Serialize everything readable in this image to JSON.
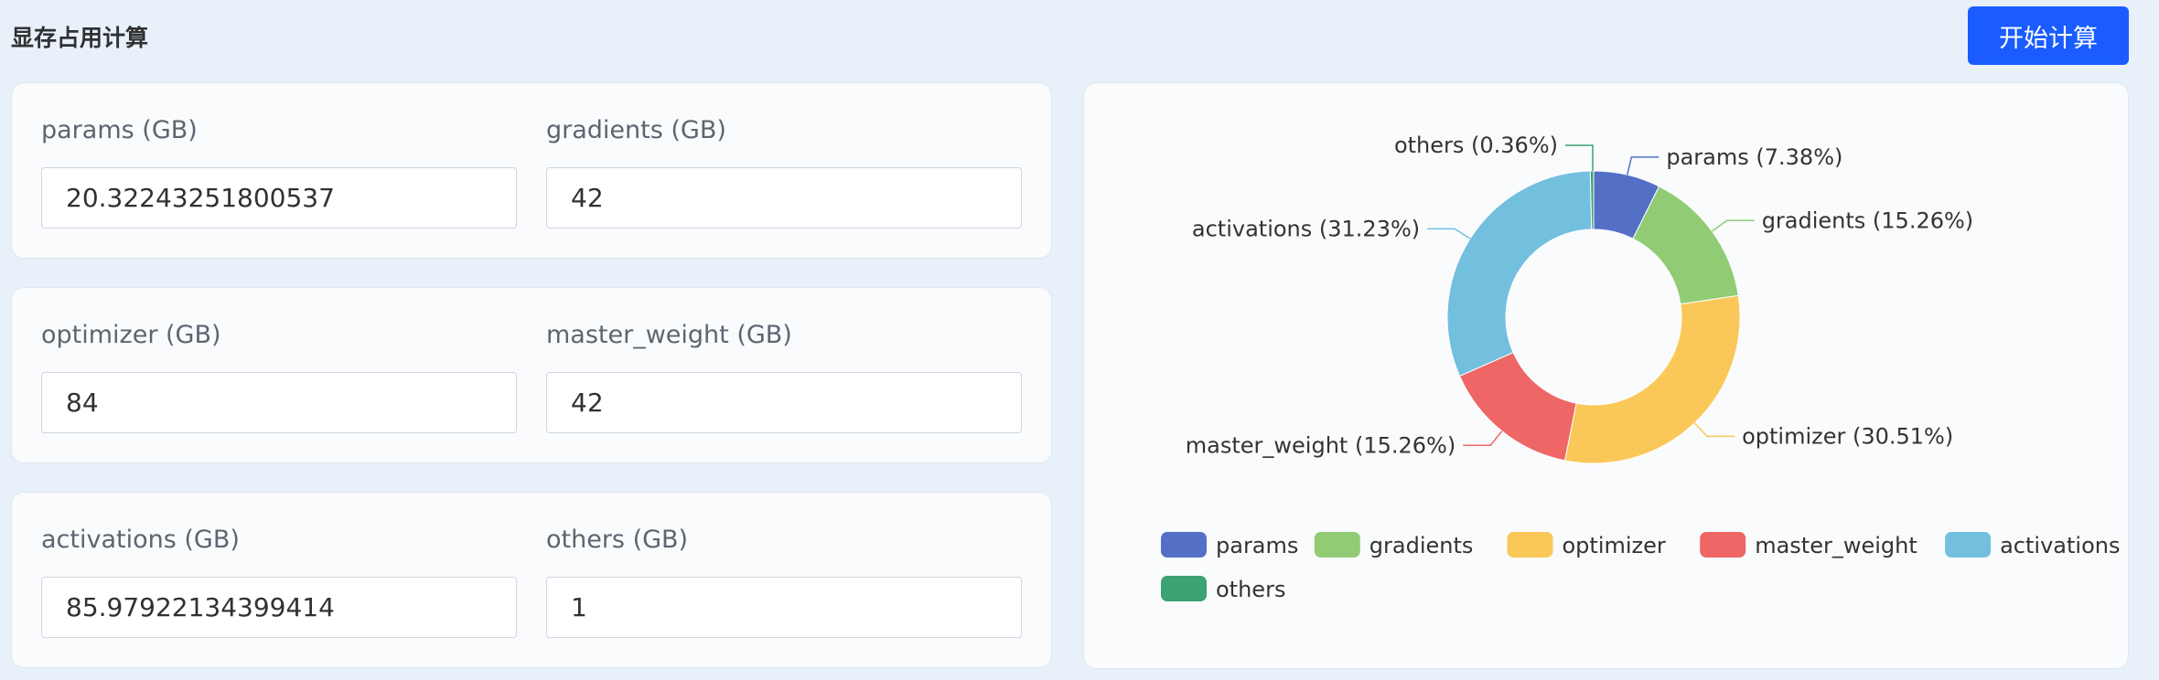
{
  "header": {
    "title": "显存占用计算",
    "start_button": "开始计算"
  },
  "fields": [
    {
      "label": "params (GB)",
      "value": "20.32243251800537"
    },
    {
      "label": "gradients (GB)",
      "value": "42"
    },
    {
      "label": "optimizer (GB)",
      "value": "84"
    },
    {
      "label": "master_weight (GB)",
      "value": "42"
    },
    {
      "label": "activations (GB)",
      "value": "85.97922134399414"
    },
    {
      "label": "others (GB)",
      "value": "1"
    }
  ],
  "chart_data": {
    "type": "pie",
    "donut": true,
    "legend_position": "bottom",
    "slices": [
      {
        "name": "params",
        "value": 20.32243251800537,
        "percent": 7.38,
        "label": "params (7.38%)",
        "color": "#5470c6"
      },
      {
        "name": "gradients",
        "value": 42,
        "percent": 15.26,
        "label": "gradients (15.26%)",
        "color": "#91cc75"
      },
      {
        "name": "optimizer",
        "value": 84,
        "percent": 30.51,
        "label": "optimizer (30.51%)",
        "color": "#fac858"
      },
      {
        "name": "master_weight",
        "value": 42,
        "percent": 15.26,
        "label": "master_weight (15.26%)",
        "color": "#ee6666"
      },
      {
        "name": "activations",
        "value": 85.97922134399414,
        "percent": 31.23,
        "label": "activations (31.23%)",
        "color": "#73c0de"
      },
      {
        "name": "others",
        "value": 1,
        "percent": 0.36,
        "label": "others (0.36%)",
        "color": "#3ba272"
      }
    ]
  }
}
